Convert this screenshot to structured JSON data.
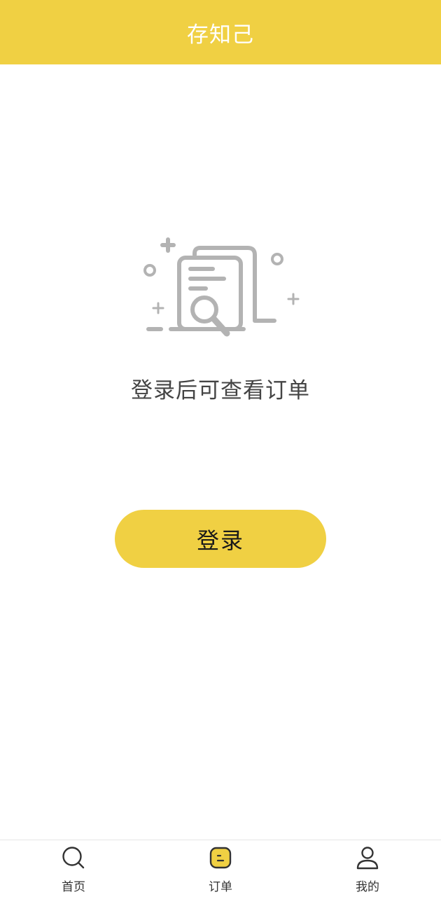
{
  "header": {
    "title": "存知己"
  },
  "empty_state": {
    "icon": "document-search-icon",
    "message": "登录后可查看订单"
  },
  "login_button": {
    "label": "登录"
  },
  "tabbar": {
    "active_tab": "订单",
    "accent_color": "#F0D043",
    "items": [
      {
        "label": "首页",
        "icon": "search-icon"
      },
      {
        "label": "订单",
        "icon": "order-icon"
      },
      {
        "label": "我的",
        "icon": "user-icon"
      }
    ]
  },
  "colors": {
    "brand": "#F0D043",
    "text_muted": "#444444"
  }
}
